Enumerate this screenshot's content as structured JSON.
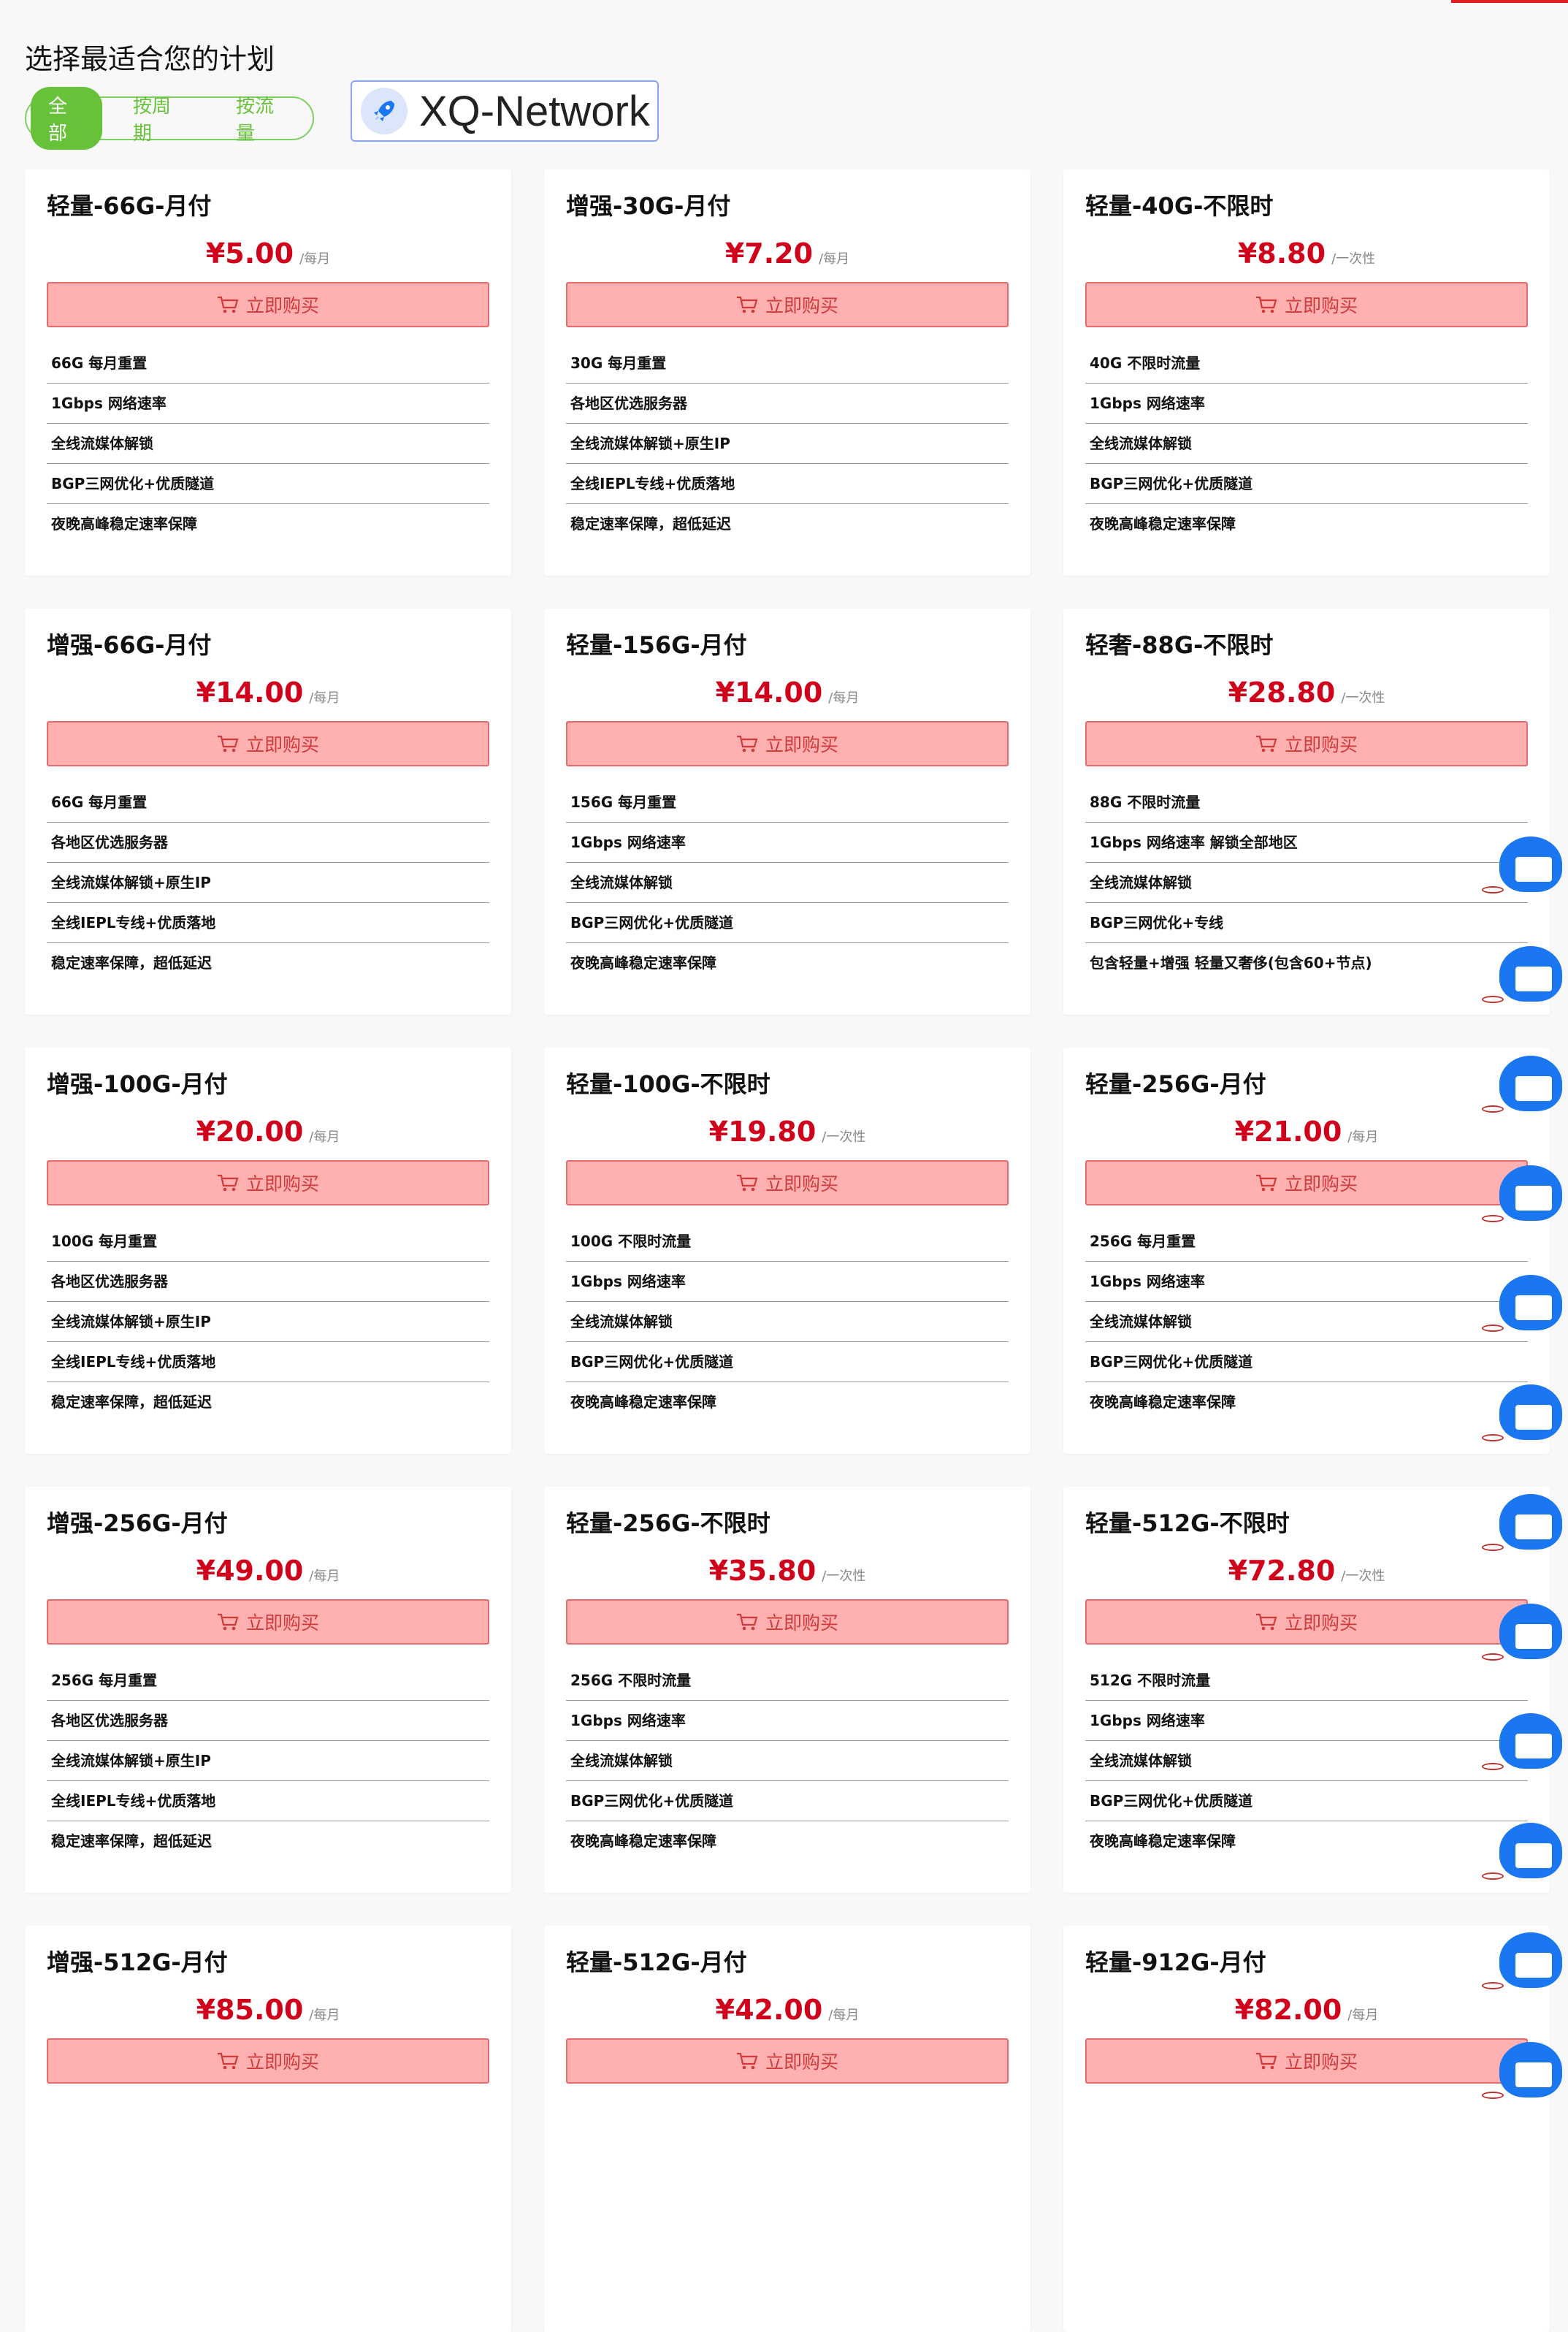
{
  "page": {
    "title": "选择最适合您的计划"
  },
  "filters": {
    "tabs": [
      "全部",
      "按周期",
      "按流量"
    ],
    "active": "全部"
  },
  "brand": {
    "name": "XQ-Network",
    "icon": "rocket-icon"
  },
  "buy_label": "立即购买",
  "colors": {
    "price": "#d0021b",
    "buy_bg": "#ffb0b0",
    "buy_border": "#e46c6c",
    "filter_green": "#67c23a",
    "chat_blue": "#1b76f2"
  },
  "plans": [
    {
      "name": "轻量-66G-月付",
      "price": "¥5.00",
      "period": "/每月",
      "features": [
        "66G 每月重置",
        "1Gbps 网络速率",
        "全线流媒体解锁",
        "BGP三网优化+优质隧道",
        "夜晚高峰稳定速率保障"
      ]
    },
    {
      "name": "增强-30G-月付",
      "price": "¥7.20",
      "period": "/每月",
      "features": [
        "30G 每月重置",
        "各地区优选服务器",
        "全线流媒体解锁+原生IP",
        "全线IEPL专线+优质落地",
        "稳定速率保障，超低延迟"
      ]
    },
    {
      "name": "轻量-40G-不限时",
      "price": "¥8.80",
      "period": "/一次性",
      "features": [
        "40G 不限时流量",
        "1Gbps 网络速率",
        "全线流媒体解锁",
        "BGP三网优化+优质隧道",
        "夜晚高峰稳定速率保障"
      ]
    },
    {
      "name": "增强-66G-月付",
      "price": "¥14.00",
      "period": "/每月",
      "features": [
        "66G 每月重置",
        "各地区优选服务器",
        "全线流媒体解锁+原生IP",
        "全线IEPL专线+优质落地",
        "稳定速率保障，超低延迟"
      ]
    },
    {
      "name": "轻量-156G-月付",
      "price": "¥14.00",
      "period": "/每月",
      "features": [
        "156G 每月重置",
        "1Gbps 网络速率",
        "全线流媒体解锁",
        "BGP三网优化+优质隧道",
        "夜晚高峰稳定速率保障"
      ]
    },
    {
      "name": "轻奢-88G-不限时",
      "price": "¥28.80",
      "period": "/一次性",
      "features": [
        "88G 不限时流量",
        "1Gbps 网络速率 解锁全部地区",
        "全线流媒体解锁",
        "BGP三网优化+专线",
        "包含轻量+增强 轻量又奢侈(包含60+节点)"
      ]
    },
    {
      "name": "增强-100G-月付",
      "price": "¥20.00",
      "period": "/每月",
      "features": [
        "100G 每月重置",
        "各地区优选服务器",
        "全线流媒体解锁+原生IP",
        "全线IEPL专线+优质落地",
        "稳定速率保障，超低延迟"
      ]
    },
    {
      "name": "轻量-100G-不限时",
      "price": "¥19.80",
      "period": "/一次性",
      "features": [
        "100G 不限时流量",
        "1Gbps 网络速率",
        "全线流媒体解锁",
        "BGP三网优化+优质隧道",
        "夜晚高峰稳定速率保障"
      ]
    },
    {
      "name": "轻量-256G-月付",
      "price": "¥21.00",
      "period": "/每月",
      "features": [
        "256G 每月重置",
        "1Gbps 网络速率",
        "全线流媒体解锁",
        "BGP三网优化+优质隧道",
        "夜晚高峰稳定速率保障"
      ]
    },
    {
      "name": "增强-256G-月付",
      "price": "¥49.00",
      "period": "/每月",
      "features": [
        "256G 每月重置",
        "各地区优选服务器",
        "全线流媒体解锁+原生IP",
        "全线IEPL专线+优质落地",
        "稳定速率保障，超低延迟"
      ]
    },
    {
      "name": "轻量-256G-不限时",
      "price": "¥35.80",
      "period": "/一次性",
      "features": [
        "256G 不限时流量",
        "1Gbps 网络速率",
        "全线流媒体解锁",
        "BGP三网优化+优质隧道",
        "夜晚高峰稳定速率保障"
      ]
    },
    {
      "name": "轻量-512G-不限时",
      "price": "¥72.80",
      "period": "/一次性",
      "features": [
        "512G 不限时流量",
        "1Gbps 网络速率",
        "全线流媒体解锁",
        "BGP三网优化+优质隧道",
        "夜晚高峰稳定速率保障"
      ]
    },
    {
      "name": "增强-512G-月付",
      "price": "¥85.00",
      "period": "/每月",
      "features": []
    },
    {
      "name": "轻量-512G-月付",
      "price": "¥42.00",
      "period": "/每月",
      "features": []
    },
    {
      "name": "轻量-912G-月付",
      "price": "¥82.00",
      "period": "/每月",
      "features": []
    }
  ],
  "chat_widget": {
    "icon": "chat-robot-icon",
    "count": 12
  }
}
